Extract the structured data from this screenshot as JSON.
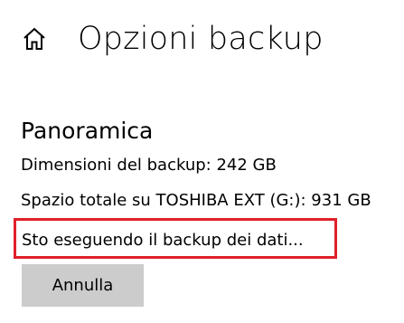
{
  "header": {
    "home_icon": "home-icon",
    "title": "Opzioni backup"
  },
  "overview": {
    "heading": "Panoramica",
    "backup_size": "Dimensioni del backup: 242 GB",
    "total_space": "Spazio totale su TOSHIBA EXT (G:): 931 GB",
    "status": "Sto eseguendo il backup dei dati..."
  },
  "actions": {
    "cancel_label": "Annulla"
  },
  "colors": {
    "highlight_border": "#e0202a",
    "button_background": "#cccccc"
  }
}
